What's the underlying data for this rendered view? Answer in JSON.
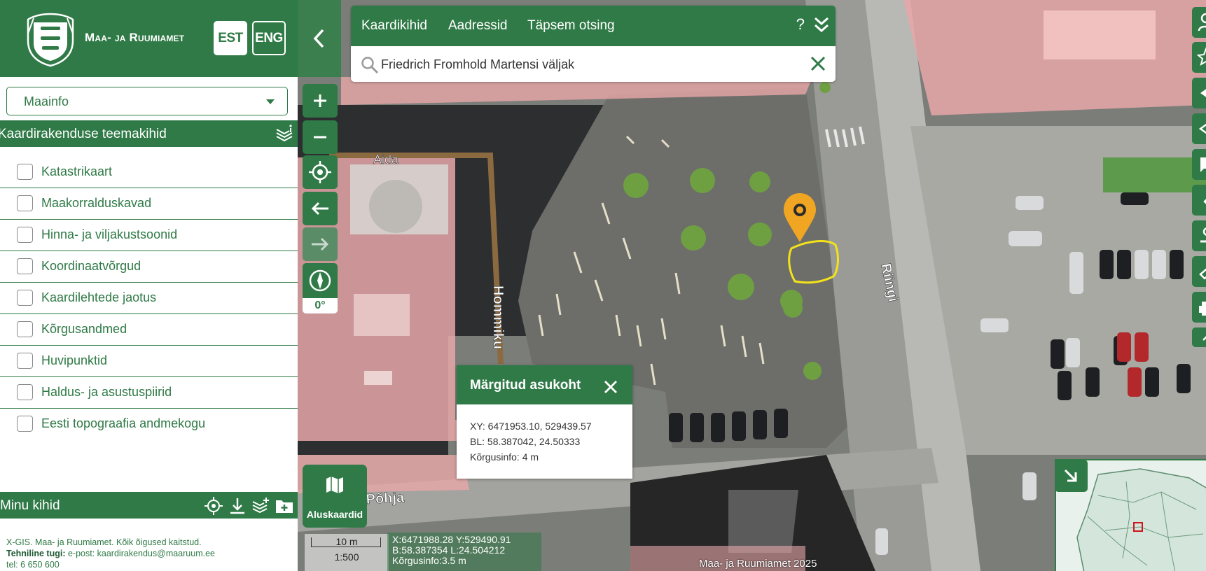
{
  "header": {
    "org_name": "Maa- ja Ruumiamet",
    "lang_est": "EST",
    "lang_eng": "ENG"
  },
  "map_selector": {
    "value": "Maainfo"
  },
  "theme_layers": {
    "title": "Kaardirakenduse teemakihid",
    "items": [
      {
        "label": "Katastrikaart",
        "checked": false
      },
      {
        "label": "Maakorralduskavad",
        "checked": false
      },
      {
        "label": "Hinna- ja viljakustsoonid",
        "checked": false
      },
      {
        "label": "Koordinaatvõrgud",
        "checked": false
      },
      {
        "label": "Kaardilehtede jaotus",
        "checked": false
      },
      {
        "label": "Kõrgusandmed",
        "checked": false
      },
      {
        "label": "Huvipunktid",
        "checked": false
      },
      {
        "label": "Haldus- ja asustuspiirid",
        "checked": false
      },
      {
        "label": "Eesti topograafia andmekogu",
        "checked": false
      }
    ]
  },
  "my_layers": {
    "title": "Minu kihid"
  },
  "footer": {
    "line1": "X-GIS. Maa- ja Ruumiamet. Kõik õigused kaitstud.",
    "support_label": "Tehniline tugi:",
    "support_email": "e-post: kaardirakendus@maaruum.ee",
    "phone": "tel: 6 650 600"
  },
  "search": {
    "tabs": [
      "Kaardikihid",
      "Aadressid",
      "Täpsem otsing"
    ],
    "help": "?",
    "value": "Friedrich Fromhold Martensi väljak"
  },
  "compass": {
    "rotation": "0°"
  },
  "popup": {
    "title": "Märgitud asukoht",
    "xy": "XY: 6471953.10, 529439.57",
    "bl": "BL: 58.387042, 24.50333",
    "height": "Kõrgusinfo: 4 m"
  },
  "basemap": {
    "label": "Aluskaardid"
  },
  "scale": {
    "distance": "10 m",
    "ratio": "1:500"
  },
  "cursor_coords": {
    "xy": "X:6471988.28 Y:529490.91",
    "bl": "B:58.387354 L:24.504212",
    "height": "Kõrgusinfo:3.5 m"
  },
  "map_labels": {
    "aida": "Aida",
    "hommiku": "Hommiku",
    "riingi": "Riingi",
    "pohja": "Põhja"
  },
  "copyright": "Maa- ja Ruumiamet 2025",
  "colors": {
    "brand_green": "#2f7a46",
    "marker_orange": "#f0a623",
    "highlight_yellow": "#f3e21a",
    "building_overlay": "#e8a6a8"
  },
  "icons": {
    "collapse": "chevron-left-icon",
    "zoom_in": "plus-icon",
    "zoom_out": "minus-icon",
    "locate": "crosshair-icon",
    "back": "arrow-left-icon",
    "forward": "arrow-right-icon",
    "compass": "compass-icon",
    "search": "search-icon",
    "clear": "close-icon",
    "basemap": "map-icon"
  }
}
